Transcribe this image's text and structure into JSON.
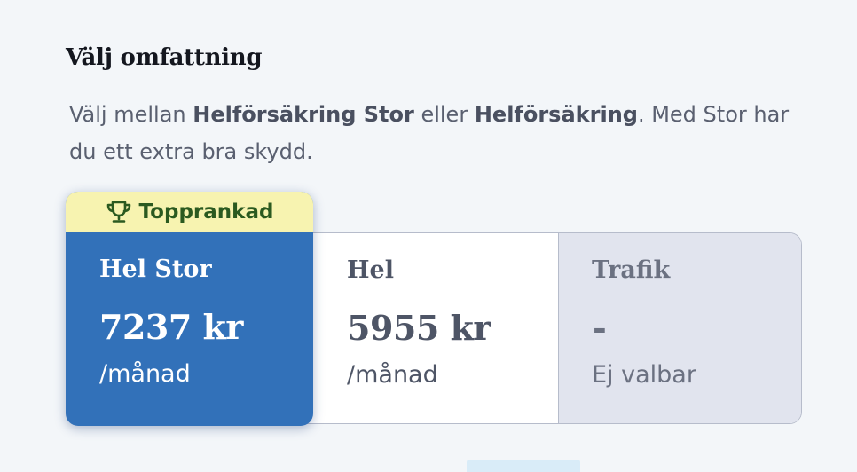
{
  "section": {
    "title": "Välj omfattning",
    "description": {
      "part1": "Välj mellan ",
      "strong1": "Helförsäkring Stor",
      "part2": " eller ",
      "strong2": "Helförsäkring",
      "part3": ". Med Stor har du ett extra bra skydd."
    }
  },
  "options": {
    "stor": {
      "badge_icon": "trophy-icon",
      "badge_label": "Topprankad",
      "name": "Hel Stor",
      "price": "7237 kr",
      "per": "/månad",
      "selected": true
    },
    "hel": {
      "name": "Hel",
      "price": "5955 kr",
      "per": "/månad",
      "selected": false
    },
    "trafik": {
      "name": "Trafik",
      "price": "-",
      "per": "Ej valbar",
      "selectable": false
    }
  },
  "colors": {
    "selected_bg": "#3271b9",
    "badge_bg": "#f7f3b0",
    "badge_text": "#2b5a20",
    "disabled_bg": "#e1e4ee",
    "border": "#b6bccb"
  }
}
